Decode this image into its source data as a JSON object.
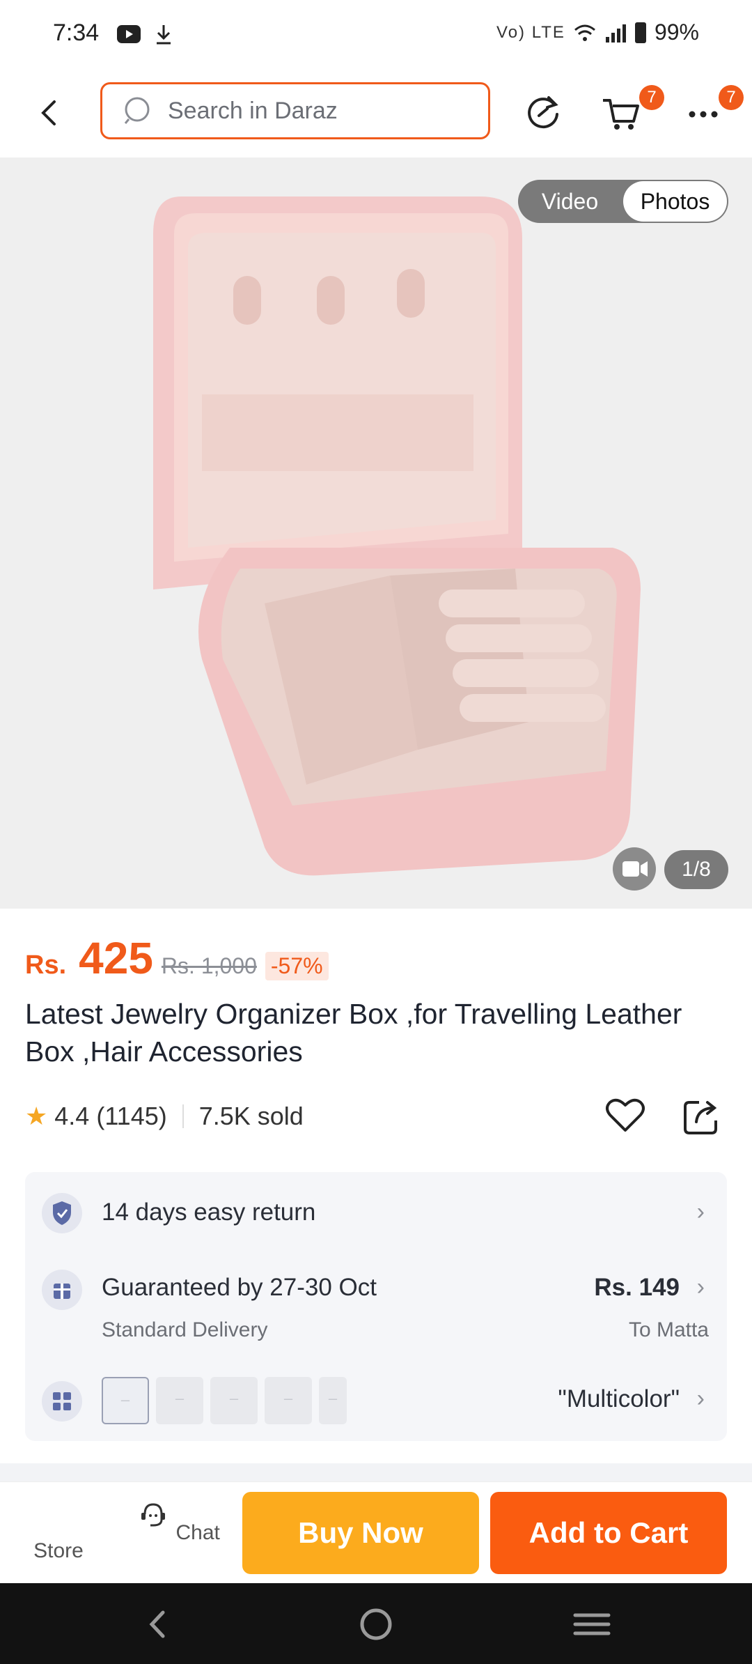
{
  "status_bar": {
    "time": "7:34",
    "battery": "99%",
    "network": "Vo) LTE"
  },
  "header": {
    "search_placeholder": "Search in Daraz",
    "cart_badge": "7",
    "more_badge": "7"
  },
  "gallery": {
    "tabs": [
      "Video",
      "Photos"
    ],
    "active_tab": "Photos",
    "counter": "1/8"
  },
  "product": {
    "currency": "Rs.",
    "price": "425",
    "original_price": "Rs. 1,000",
    "discount": "-57%",
    "title": "Latest Jewelry Organizer Box ,for Travelling Leather Box ,Hair Accessories",
    "rating": "4.4",
    "reviews": "(1145)",
    "sold": "7.5K sold"
  },
  "info": {
    "return_label": "14 days easy return",
    "delivery_label": "Guaranteed by 27-30 Oct",
    "delivery_type": "Standard Delivery",
    "delivery_fee": "Rs. 149",
    "delivery_location": "To Matta",
    "variant_value": "\"Multicolor\""
  },
  "bottom_bar": {
    "store_label": "Store",
    "chat_label": "Chat",
    "buy_now": "Buy Now",
    "add_to_cart": "Add to Cart"
  },
  "colors": {
    "brand": "#f05a1a",
    "buy_now": "#fcab1d",
    "add_to_cart": "#fa5c10",
    "rating_star": "#f5a623"
  },
  "icons": [
    "back-icon",
    "search-icon",
    "refresh-icon",
    "cart-icon",
    "more-icon",
    "heart-icon",
    "share-icon",
    "shield-icon",
    "gift-icon",
    "grid-icon",
    "store-icon",
    "chat-icon",
    "video-icon"
  ]
}
